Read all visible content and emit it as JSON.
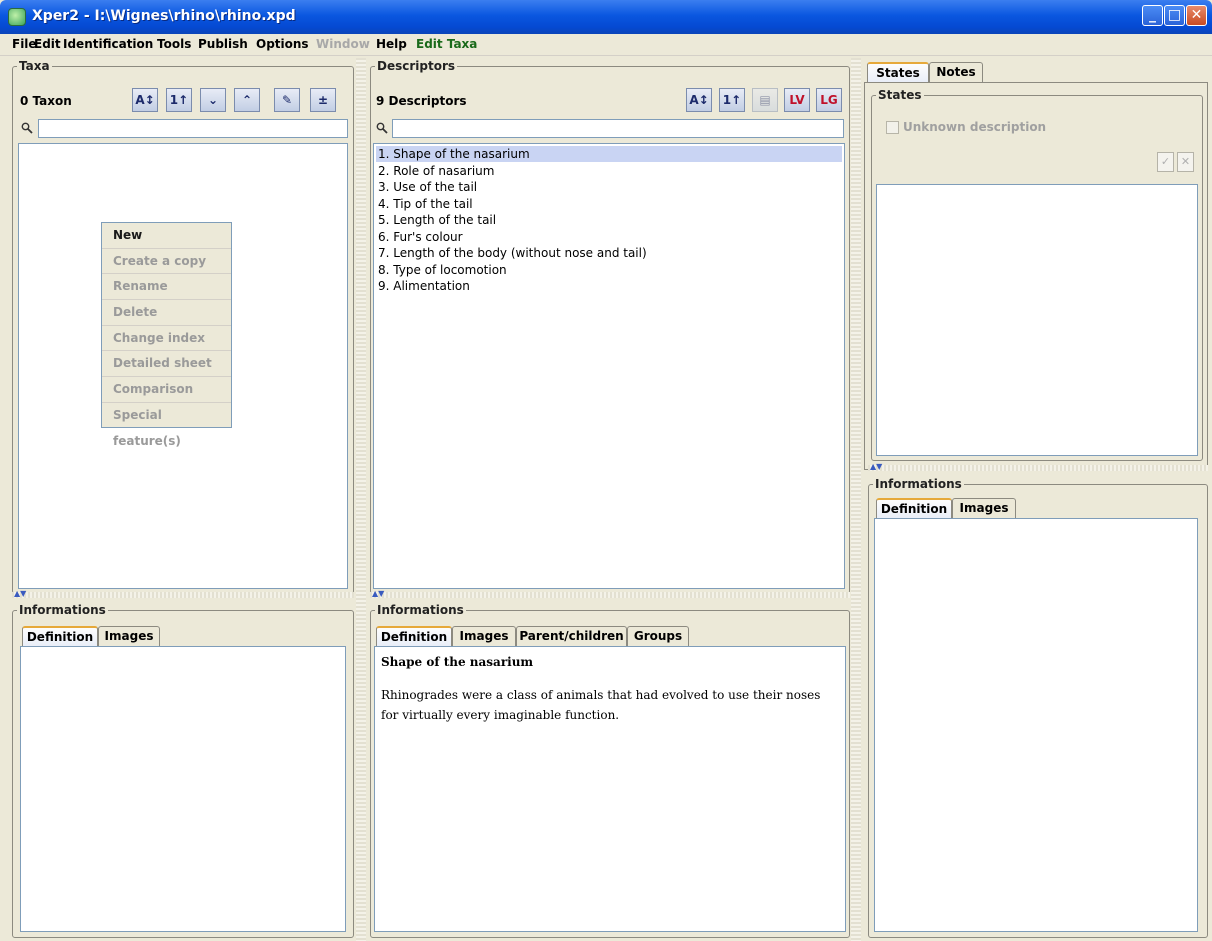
{
  "window": {
    "title": "Xper2 - I:\\Wignes\\rhino\\rhino.xpd"
  },
  "menubar": [
    {
      "label": "File"
    },
    {
      "label": "Edit"
    },
    {
      "label": "Identification"
    },
    {
      "label": "Tools"
    },
    {
      "label": "Publish"
    },
    {
      "label": "Options"
    },
    {
      "label": "Window"
    },
    {
      "label": "Help"
    },
    {
      "label": "Edit Taxa"
    }
  ],
  "taxa": {
    "title": "Taxa",
    "count": "0 Taxon",
    "search_value": "",
    "context_menu": [
      "New",
      "Create a copy",
      "Rename",
      "Delete",
      "Change index",
      "Detailed sheet",
      "Comparison",
      "Special feature(s)"
    ],
    "toolbar_icons": [
      "sort-az-icon",
      "sort-index-icon",
      "move-down-icon",
      "move-up-icon",
      "edit-icon",
      "add-taxon-icon"
    ]
  },
  "descriptors": {
    "title": "Descriptors",
    "count": "9 Descriptors",
    "search_value": "",
    "items": [
      "1. Shape of the nasarium",
      "2. Role of nasarium",
      "3. Use of the tail",
      "4. Tip of the tail",
      "5. Length of the tail",
      "6. Fur's colour",
      "7. Length of the body (without nose and tail)",
      "8. Type of locomotion",
      "9. Alimentation"
    ],
    "selected_index": 0,
    "toolbar_icons": [
      "sort-az-icon",
      "sort-index-icon",
      "group-icon",
      "list-variable-icon",
      "list-group-icon"
    ]
  },
  "taxa_info": {
    "title": "Informations",
    "tabs": [
      "Definition",
      "Images"
    ]
  },
  "descriptor_info": {
    "title": "Informations",
    "tabs": [
      "Definition",
      "Images",
      "Parent/children",
      "Groups"
    ],
    "definition_title": "Shape of the nasarium",
    "definition_text": "Rhinogrades were a class of animals that had evolved to use their noses for virtually every imaginable function."
  },
  "states_panel": {
    "tabs": [
      "States",
      "Notes"
    ],
    "group_title": "States",
    "unknown_label": "Unknown description",
    "info_title": "Informations",
    "info_tabs": [
      "Definition",
      "Images"
    ]
  },
  "colors": {
    "titlebar": "#0a57e0",
    "selection": "#c9d4f3",
    "menu_green": "#1a6a1a"
  }
}
